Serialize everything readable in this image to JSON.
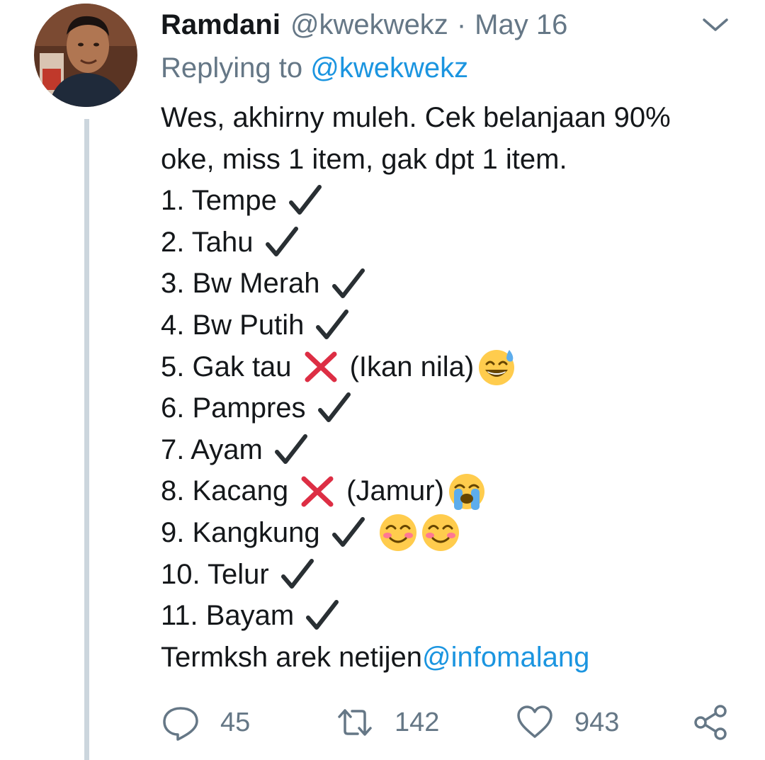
{
  "tweet": {
    "display_name": "Ramdani",
    "handle": "@kwekwekz",
    "separator": "·",
    "date": "May 16",
    "replying_prefix": "Replying to ",
    "replying_handle": "@kwekwekz",
    "intro_line1": "Wes, akhirny muleh. Cek belanjaan 90%",
    "intro_line2": "oke, miss 1 item, gak dpt 1 item.",
    "items": [
      "1. Tempe",
      "2. Tahu",
      "3. Bw Merah",
      "4. Bw Putih",
      "5. Gak tau",
      "6. Pampres",
      "7. Ayam",
      "8. Kacang",
      "9. Kangkung",
      "10. Telur",
      "11. Bayam"
    ],
    "item5_note": "(Ikan nila)",
    "item8_note": "(Jamur)",
    "closing_text": "Termksh arek netijen ",
    "closing_mention": "@infomalang"
  },
  "actions": {
    "reply_count": "45",
    "retweet_count": "142",
    "like_count": "943"
  },
  "icons": {
    "check": "heavy-check-mark-icon",
    "cross": "cross-mark-icon",
    "sweat_smile": "sweat-smile-emoji",
    "loud_cry": "loudly-crying-emoji",
    "blush": "blush-emoji",
    "reply": "reply-icon",
    "retweet": "retweet-icon",
    "like": "heart-icon",
    "share": "share-icon",
    "more": "chevron-down-icon"
  },
  "colors": {
    "text": "#14171a",
    "secondary": "#657786",
    "link": "#1b95e0",
    "thread_line": "#ccd6dd",
    "cross": "#dd2e44",
    "emoji_yellow": "#ffcc4d"
  }
}
